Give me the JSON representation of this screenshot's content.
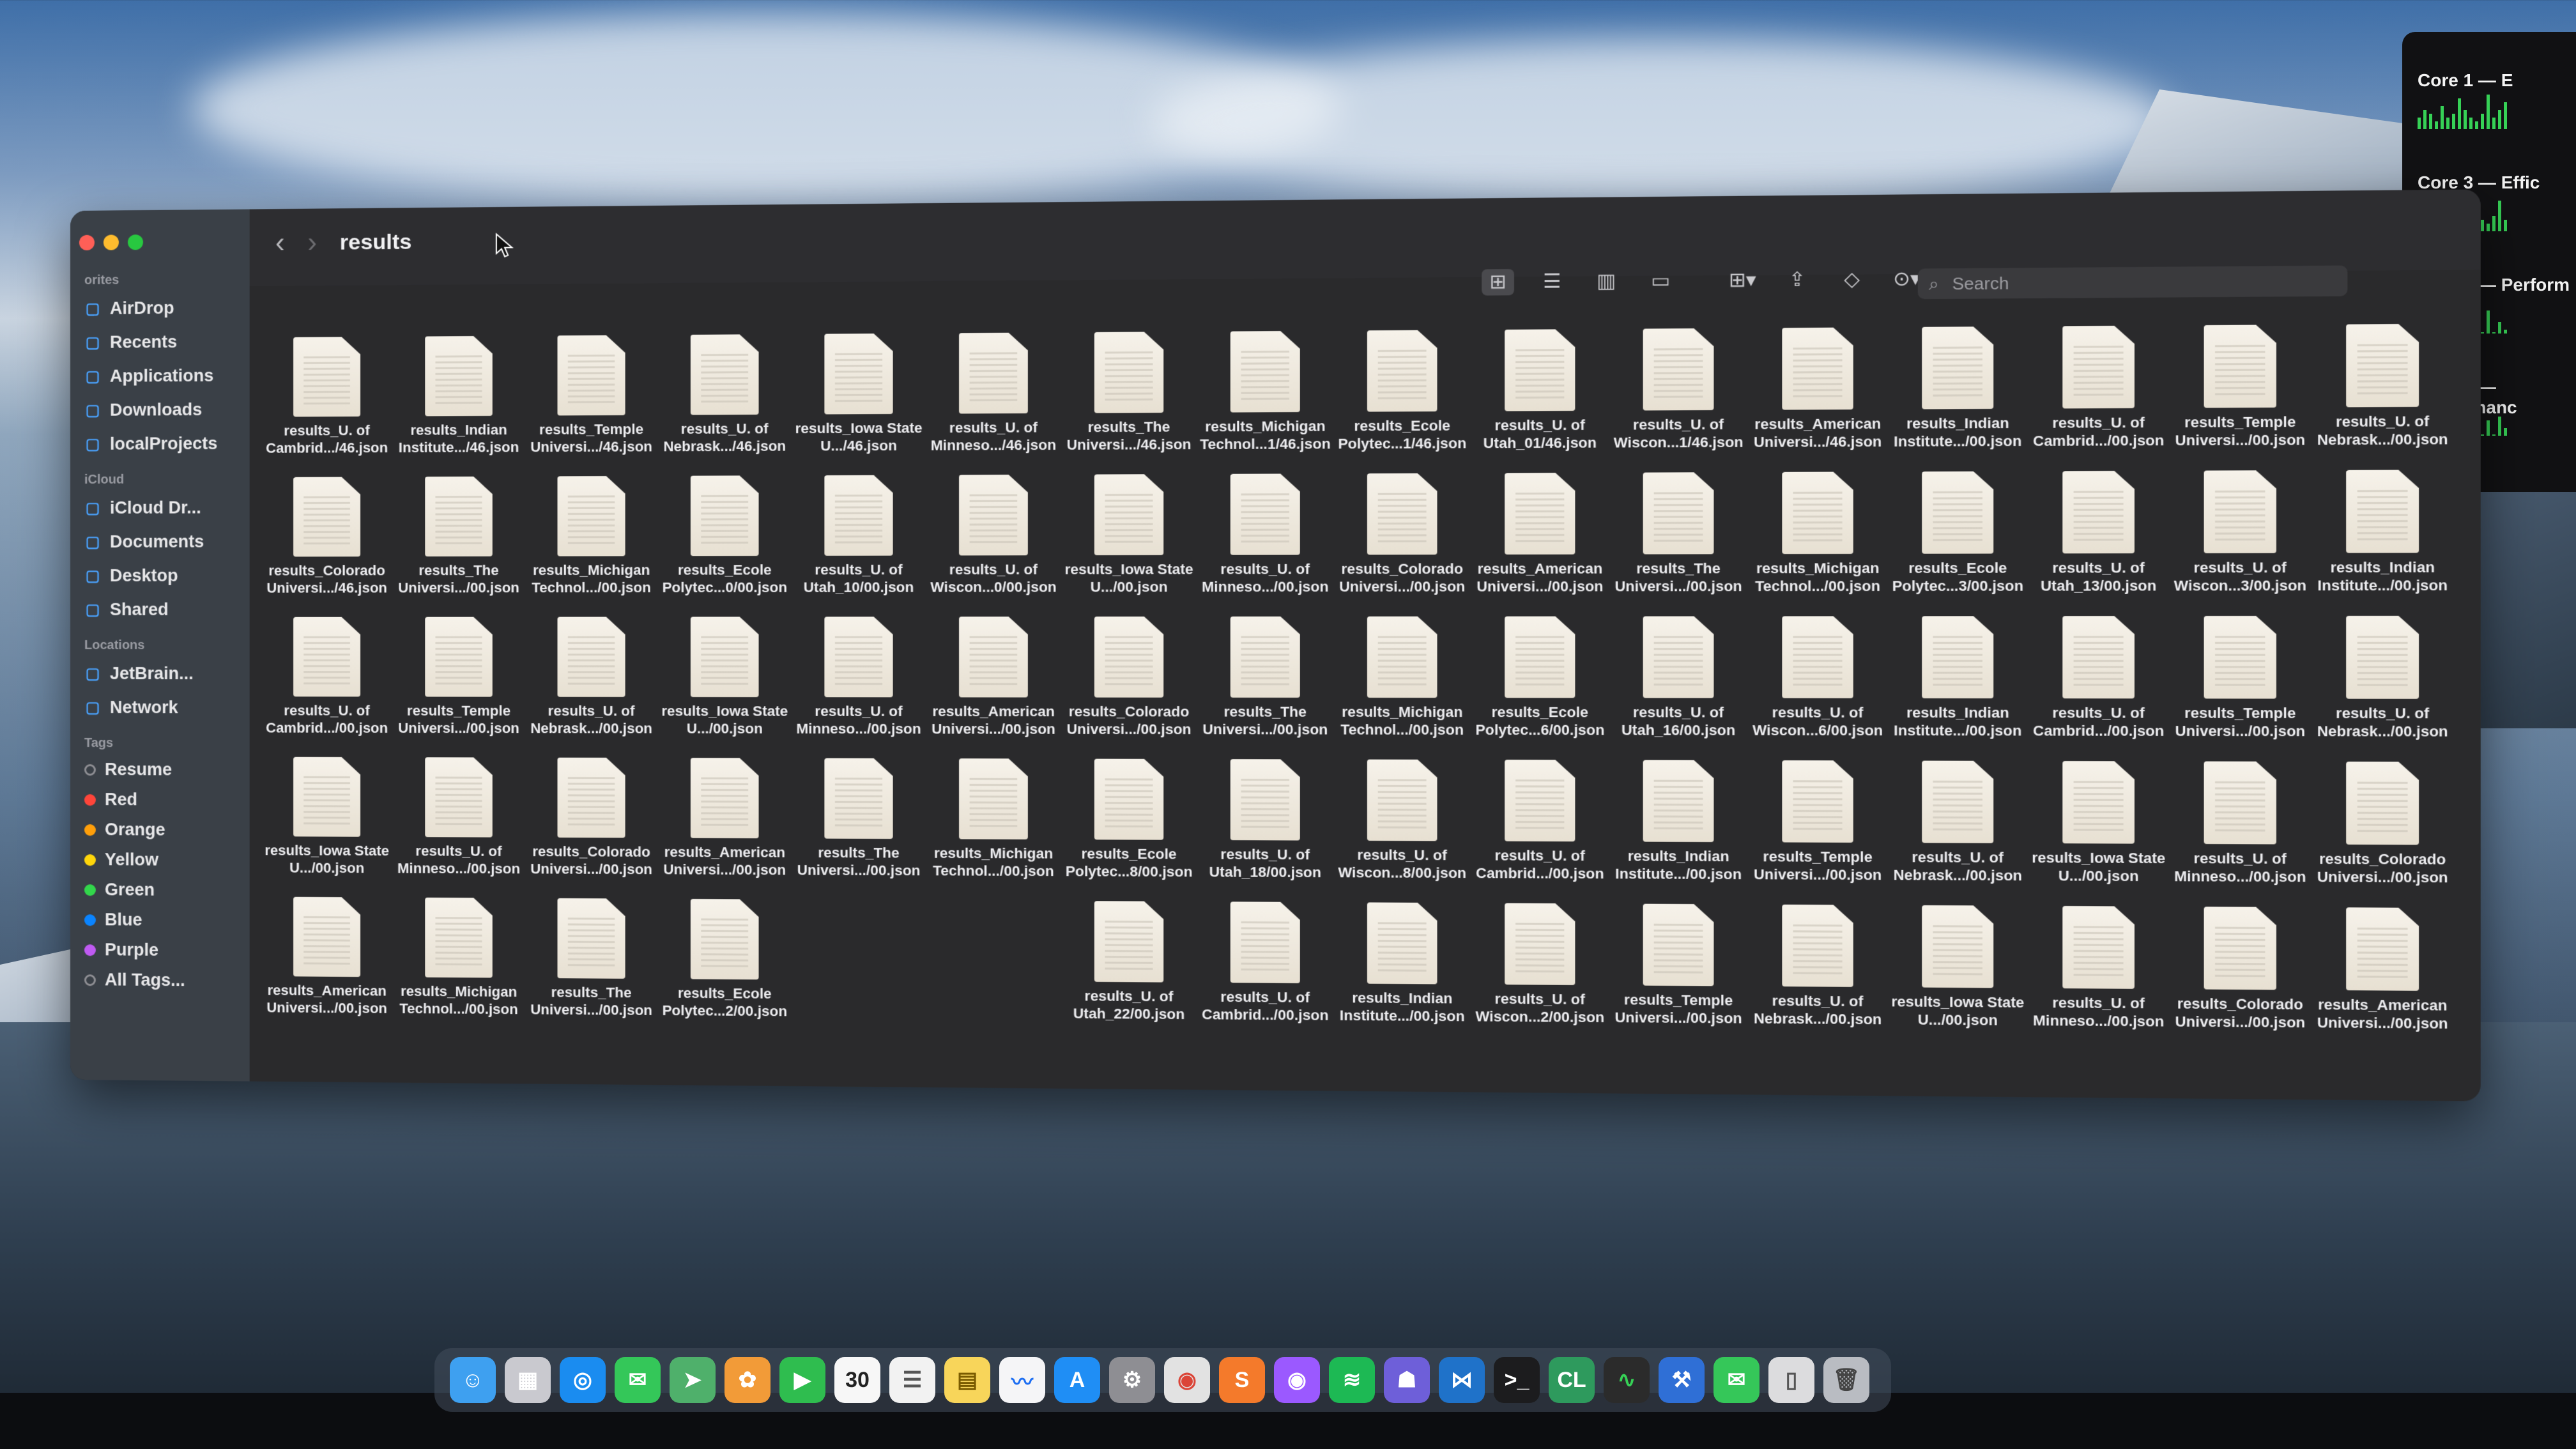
{
  "window": {
    "title": "results"
  },
  "sidebar": {
    "favorites_label": "orites",
    "favorites": [
      {
        "label": "AirDrop",
        "icon": "airdrop-icon"
      },
      {
        "label": "Recents",
        "icon": "clock-icon"
      },
      {
        "label": "Applications",
        "icon": "applications-icon"
      },
      {
        "label": "Downloads",
        "icon": "downloads-icon"
      },
      {
        "label": "localProjects",
        "icon": "folder-icon"
      }
    ],
    "icloud_label": "iCloud",
    "icloud": [
      {
        "label": "iCloud Dr...",
        "icon": "cloud-icon"
      },
      {
        "label": "Documents",
        "icon": "document-icon"
      },
      {
        "label": "Desktop",
        "icon": "desktop-icon"
      },
      {
        "label": "Shared",
        "icon": "shared-folder-icon"
      }
    ],
    "locations_label": "Locations",
    "locations": [
      {
        "label": "JetBrain...",
        "icon": "disk-icon"
      },
      {
        "label": "Network",
        "icon": "network-icon"
      }
    ],
    "tags_label": "Tags",
    "tags": [
      {
        "label": "Resume",
        "color": "#8e8e93",
        "hollow": true
      },
      {
        "label": "Red",
        "color": "#ff453a"
      },
      {
        "label": "Orange",
        "color": "#ff9f0a"
      },
      {
        "label": "Yellow",
        "color": "#ffd60a"
      },
      {
        "label": "Green",
        "color": "#32d74b"
      },
      {
        "label": "Blue",
        "color": "#0a84ff"
      },
      {
        "label": "Purple",
        "color": "#bf5af2"
      },
      {
        "label": "All Tags...",
        "color": "#8e8e93",
        "hollow": true
      }
    ]
  },
  "toolbar": {
    "search_placeholder": "Search"
  },
  "files": [
    [
      "results_U. of Cambrid.../46.json",
      "results_Indian Institute.../46.json",
      "results_Temple Universi.../46.json",
      "results_U. of Nebrask.../46.json",
      "results_Iowa State U.../46.json",
      "results_U. of Minneso.../46.json",
      "results_The Universi.../46.json",
      "results_Michigan Technol...1/46.json",
      "results_Ecole Polytec...1/46.json",
      "results_U. of Utah_01/46.json",
      "results_U. of Wiscon...1/46.json",
      "results_American Universi.../46.json",
      "results_Indian Institute.../00.json",
      "results_U. of Cambrid.../00.json",
      "results_Temple Universi.../00.json",
      "results_U. of Nebrask.../00.json"
    ],
    [
      "results_Colorado Universi.../46.json",
      "results_The Universi.../00.json",
      "results_Michigan Technol.../00.json",
      "results_Ecole Polytec...0/00.json",
      "results_U. of Utah_10/00.json",
      "results_U. of Wiscon...0/00.json",
      "results_Iowa State U.../00.json",
      "results_U. of Minneso.../00.json",
      "results_Colorado Universi.../00.json",
      "results_American Universi.../00.json",
      "results_The Universi.../00.json",
      "results_Michigan Technol.../00.json",
      "results_Ecole Polytec...3/00.json",
      "results_U. of Utah_13/00.json",
      "results_U. of Wiscon...3/00.json",
      "results_Indian Institute.../00.json"
    ],
    [
      "results_U. of Cambrid.../00.json",
      "results_Temple Universi.../00.json",
      "results_U. of Nebrask.../00.json",
      "results_Iowa State U.../00.json",
      "results_U. of Minneso.../00.json",
      "results_American Universi.../00.json",
      "results_Colorado Universi.../00.json",
      "results_The Universi.../00.json",
      "results_Michigan Technol.../00.json",
      "results_Ecole Polytec...6/00.json",
      "results_U. of Utah_16/00.json",
      "results_U. of Wiscon...6/00.json",
      "results_Indian Institute.../00.json",
      "results_U. of Cambrid.../00.json",
      "results_Temple Universi.../00.json",
      "results_U. of Nebrask.../00.json"
    ],
    [
      "results_Iowa State U.../00.json",
      "results_U. of Minneso.../00.json",
      "results_Colorado Universi.../00.json",
      "results_American Universi.../00.json",
      "results_The Universi.../00.json",
      "results_Michigan Technol.../00.json",
      "results_Ecole Polytec...8/00.json",
      "results_U. of Utah_18/00.json",
      "results_U. of Wiscon...8/00.json",
      "results_U. of Cambrid.../00.json",
      "results_Indian Institute.../00.json",
      "results_Temple Universi.../00.json",
      "results_U. of Nebrask.../00.json",
      "results_Iowa State U.../00.json",
      "results_U. of Minneso.../00.json",
      "results_Colorado Universi.../00.json"
    ],
    [
      "results_American Universi.../00.json",
      "results_Michigan Technol.../00.json",
      "results_The Universi.../00.json",
      "results_Ecole Polytec...2/00.json",
      "",
      "",
      "results_U. of Utah_22/00.json",
      "results_U. of Cambrid.../00.json",
      "results_Indian Institute.../00.json",
      "results_U. of Wiscon...2/00.json",
      "results_Temple Universi.../00.json",
      "results_U. of Nebrask.../00.json",
      "results_Iowa State U.../00.json",
      "results_U. of Minneso.../00.json",
      "results_Colorado Universi.../00.json",
      "results_American Universi.../00.json"
    ]
  ],
  "widget": {
    "cores": [
      {
        "label": "Core 1 — E",
        "bars": [
          0.3,
          0.5,
          0.4,
          0.2,
          0.6,
          0.3,
          0.4,
          0.8,
          0.5,
          0.3,
          0.2,
          0.4,
          0.9,
          0.3,
          0.5,
          0.7
        ]
      },
      {
        "label": "Core 3 — Effic",
        "bars": [
          0.2,
          0.3,
          0.2,
          0.4,
          0.3,
          0.2,
          0.3,
          0.5,
          0.2,
          0.3,
          0.6,
          0.3,
          0.2,
          0.4,
          0.8,
          0.3
        ]
      },
      {
        "label": "Core 5 — Perform",
        "bars": [
          0.1,
          0.0,
          0.2,
          0.0,
          0.1,
          0.0,
          0.1,
          0.3,
          0.0,
          0.1,
          0.2,
          0.0,
          0.6,
          0.0,
          0.3,
          0.1
        ]
      },
      {
        "label": "Core 7 — Performanc",
        "bars": [
          0.0,
          0.1,
          0.0,
          0.0,
          0.1,
          0.0,
          0.0,
          0.2,
          0.0,
          0.1,
          0.0,
          0.0,
          0.4,
          0.0,
          0.5,
          0.2
        ]
      }
    ]
  },
  "dock": [
    {
      "name": "finder-icon",
      "color": "#3ea0f0",
      "glyph": "☺"
    },
    {
      "name": "launchpad-icon",
      "color": "#c9c9cf",
      "glyph": "▦"
    },
    {
      "name": "safari-icon",
      "color": "#1a8cf0",
      "glyph": "◎"
    },
    {
      "name": "messages-icon",
      "color": "#34c759",
      "glyph": "✉"
    },
    {
      "name": "maps-icon",
      "color": "#4fb06b",
      "glyph": "➤"
    },
    {
      "name": "photos-icon",
      "color": "#f29b38",
      "glyph": "✿"
    },
    {
      "name": "facetime-icon",
      "color": "#2fbd4f",
      "glyph": "▶"
    },
    {
      "name": "calendar-icon",
      "color": "#f7f7f7",
      "glyph": "30",
      "text_color": "#222"
    },
    {
      "name": "reminders-icon",
      "color": "#f2f2f2",
      "glyph": "☰",
      "text_color": "#555"
    },
    {
      "name": "notes-icon",
      "color": "#f8d55a",
      "glyph": "▤",
      "text_color": "#7a5b00"
    },
    {
      "name": "freeform-icon",
      "color": "#f5f5f7",
      "glyph": "〰",
      "text_color": "#1d6ef2"
    },
    {
      "name": "app-store-icon",
      "color": "#1f8ef5",
      "glyph": "A"
    },
    {
      "name": "system-settings-icon",
      "color": "#8e8e93",
      "glyph": "⚙"
    },
    {
      "name": "chrome-icon",
      "color": "#e2e2e2",
      "glyph": "◉",
      "text_color": "#db4437"
    },
    {
      "name": "sublime-icon",
      "color": "#f47a2b",
      "glyph": "S"
    },
    {
      "name": "podcast-icon",
      "color": "#9b59ff",
      "glyph": "◉"
    },
    {
      "name": "spotify-icon",
      "color": "#1db954",
      "glyph": "≋"
    },
    {
      "name": "github-icon",
      "color": "#6e5fd9",
      "glyph": "☗"
    },
    {
      "name": "vscode-icon",
      "color": "#1f72c9",
      "glyph": "⋈"
    },
    {
      "name": "terminal-icon",
      "color": "#1c1c1e",
      "glyph": ">_"
    },
    {
      "name": "clion-icon",
      "color": "#2e9a5d",
      "glyph": "CL"
    },
    {
      "name": "activity-monitor-icon",
      "color": "#2b2b2b",
      "glyph": "∿",
      "text_color": "#36d156"
    },
    {
      "name": "xcode-icon",
      "color": "#2f6fd6",
      "glyph": "⚒"
    },
    {
      "name": "messages-alt-icon",
      "color": "#35c759",
      "glyph": "✉"
    },
    {
      "name": "document-icon",
      "color": "#dcdcde",
      "glyph": "▯",
      "text_color": "#555"
    },
    {
      "name": "trash-icon",
      "color": "#b9bcc2",
      "glyph": "🗑",
      "text_color": "#444"
    }
  ]
}
